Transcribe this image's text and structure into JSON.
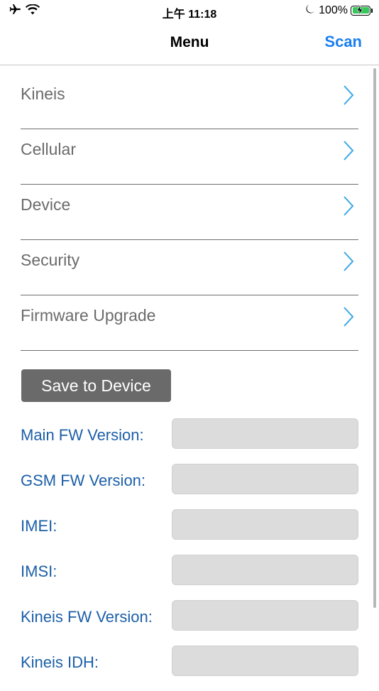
{
  "status": {
    "time": "上午 11:18",
    "battery_percent": "100%",
    "icons": [
      "airplane-icon",
      "wifi-icon",
      "moon-icon",
      "battery-charging-icon"
    ]
  },
  "nav": {
    "title": "Menu",
    "scan_label": "Scan"
  },
  "menu": {
    "items": [
      {
        "label": "Kineis"
      },
      {
        "label": "Cellular"
      },
      {
        "label": "Device"
      },
      {
        "label": "Security"
      },
      {
        "label": "Firmware Upgrade"
      }
    ]
  },
  "actions": {
    "save_label": "Save to Device"
  },
  "info": {
    "fields": [
      {
        "label": "Main FW Version:",
        "value": ""
      },
      {
        "label": "GSM FW Version:",
        "value": ""
      },
      {
        "label": "IMEI:",
        "value": ""
      },
      {
        "label": "IMSI:",
        "value": ""
      },
      {
        "label": "Kineis FW Version:",
        "value": ""
      },
      {
        "label": "Kineis IDH:",
        "value": ""
      }
    ]
  },
  "colors": {
    "accent": "#1a7ff0",
    "chevron": "#3aa8e6",
    "info_label": "#1c5fa8",
    "button_bg": "#6a6a6a",
    "battery": "#34c759"
  }
}
